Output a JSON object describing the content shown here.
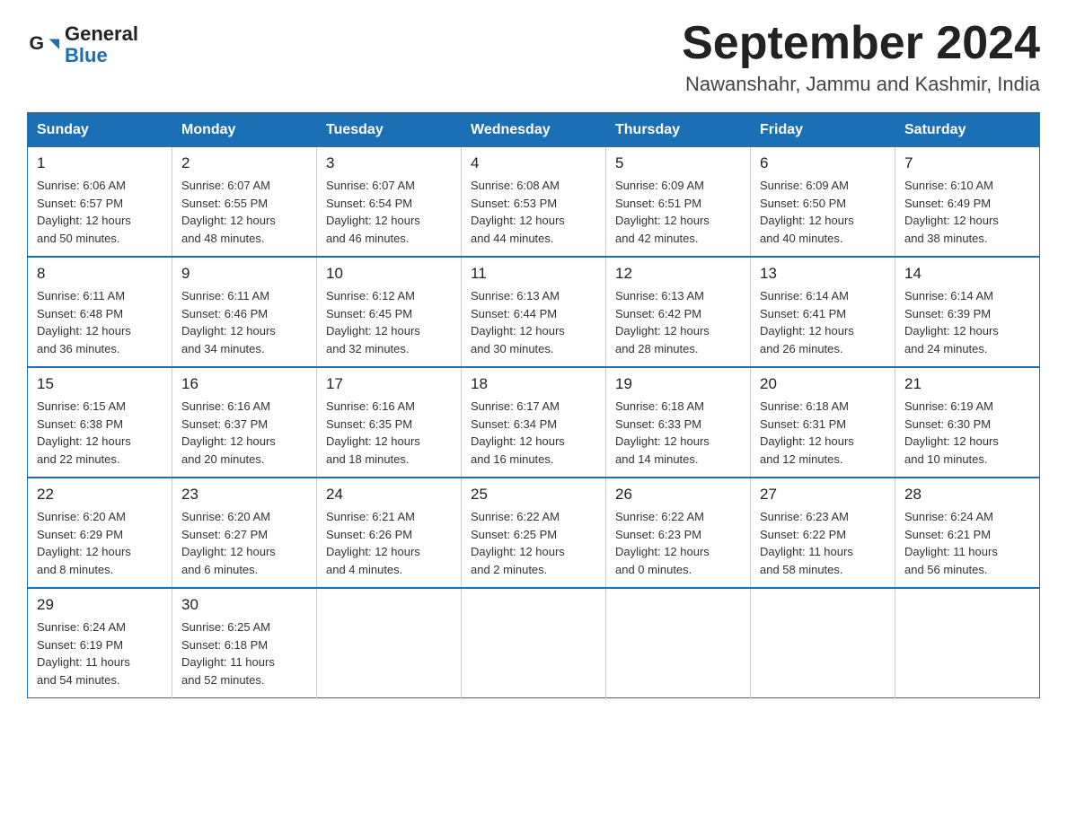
{
  "header": {
    "logo_general": "General",
    "logo_blue": "Blue",
    "month_title": "September 2024",
    "location": "Nawanshahr, Jammu and Kashmir, India"
  },
  "weekdays": [
    "Sunday",
    "Monday",
    "Tuesday",
    "Wednesday",
    "Thursday",
    "Friday",
    "Saturday"
  ],
  "weeks": [
    [
      {
        "day": "1",
        "sunrise": "6:06 AM",
        "sunset": "6:57 PM",
        "daylight": "12 hours and 50 minutes."
      },
      {
        "day": "2",
        "sunrise": "6:07 AM",
        "sunset": "6:55 PM",
        "daylight": "12 hours and 48 minutes."
      },
      {
        "day": "3",
        "sunrise": "6:07 AM",
        "sunset": "6:54 PM",
        "daylight": "12 hours and 46 minutes."
      },
      {
        "day": "4",
        "sunrise": "6:08 AM",
        "sunset": "6:53 PM",
        "daylight": "12 hours and 44 minutes."
      },
      {
        "day": "5",
        "sunrise": "6:09 AM",
        "sunset": "6:51 PM",
        "daylight": "12 hours and 42 minutes."
      },
      {
        "day": "6",
        "sunrise": "6:09 AM",
        "sunset": "6:50 PM",
        "daylight": "12 hours and 40 minutes."
      },
      {
        "day": "7",
        "sunrise": "6:10 AM",
        "sunset": "6:49 PM",
        "daylight": "12 hours and 38 minutes."
      }
    ],
    [
      {
        "day": "8",
        "sunrise": "6:11 AM",
        "sunset": "6:48 PM",
        "daylight": "12 hours and 36 minutes."
      },
      {
        "day": "9",
        "sunrise": "6:11 AM",
        "sunset": "6:46 PM",
        "daylight": "12 hours and 34 minutes."
      },
      {
        "day": "10",
        "sunrise": "6:12 AM",
        "sunset": "6:45 PM",
        "daylight": "12 hours and 32 minutes."
      },
      {
        "day": "11",
        "sunrise": "6:13 AM",
        "sunset": "6:44 PM",
        "daylight": "12 hours and 30 minutes."
      },
      {
        "day": "12",
        "sunrise": "6:13 AM",
        "sunset": "6:42 PM",
        "daylight": "12 hours and 28 minutes."
      },
      {
        "day": "13",
        "sunrise": "6:14 AM",
        "sunset": "6:41 PM",
        "daylight": "12 hours and 26 minutes."
      },
      {
        "day": "14",
        "sunrise": "6:14 AM",
        "sunset": "6:39 PM",
        "daylight": "12 hours and 24 minutes."
      }
    ],
    [
      {
        "day": "15",
        "sunrise": "6:15 AM",
        "sunset": "6:38 PM",
        "daylight": "12 hours and 22 minutes."
      },
      {
        "day": "16",
        "sunrise": "6:16 AM",
        "sunset": "6:37 PM",
        "daylight": "12 hours and 20 minutes."
      },
      {
        "day": "17",
        "sunrise": "6:16 AM",
        "sunset": "6:35 PM",
        "daylight": "12 hours and 18 minutes."
      },
      {
        "day": "18",
        "sunrise": "6:17 AM",
        "sunset": "6:34 PM",
        "daylight": "12 hours and 16 minutes."
      },
      {
        "day": "19",
        "sunrise": "6:18 AM",
        "sunset": "6:33 PM",
        "daylight": "12 hours and 14 minutes."
      },
      {
        "day": "20",
        "sunrise": "6:18 AM",
        "sunset": "6:31 PM",
        "daylight": "12 hours and 12 minutes."
      },
      {
        "day": "21",
        "sunrise": "6:19 AM",
        "sunset": "6:30 PM",
        "daylight": "12 hours and 10 minutes."
      }
    ],
    [
      {
        "day": "22",
        "sunrise": "6:20 AM",
        "sunset": "6:29 PM",
        "daylight": "12 hours and 8 minutes."
      },
      {
        "day": "23",
        "sunrise": "6:20 AM",
        "sunset": "6:27 PM",
        "daylight": "12 hours and 6 minutes."
      },
      {
        "day": "24",
        "sunrise": "6:21 AM",
        "sunset": "6:26 PM",
        "daylight": "12 hours and 4 minutes."
      },
      {
        "day": "25",
        "sunrise": "6:22 AM",
        "sunset": "6:25 PM",
        "daylight": "12 hours and 2 minutes."
      },
      {
        "day": "26",
        "sunrise": "6:22 AM",
        "sunset": "6:23 PM",
        "daylight": "12 hours and 0 minutes."
      },
      {
        "day": "27",
        "sunrise": "6:23 AM",
        "sunset": "6:22 PM",
        "daylight": "11 hours and 58 minutes."
      },
      {
        "day": "28",
        "sunrise": "6:24 AM",
        "sunset": "6:21 PM",
        "daylight": "11 hours and 56 minutes."
      }
    ],
    [
      {
        "day": "29",
        "sunrise": "6:24 AM",
        "sunset": "6:19 PM",
        "daylight": "11 hours and 54 minutes."
      },
      {
        "day": "30",
        "sunrise": "6:25 AM",
        "sunset": "6:18 PM",
        "daylight": "11 hours and 52 minutes."
      },
      null,
      null,
      null,
      null,
      null
    ]
  ],
  "labels": {
    "sunrise": "Sunrise:",
    "sunset": "Sunset:",
    "daylight": "Daylight:"
  }
}
